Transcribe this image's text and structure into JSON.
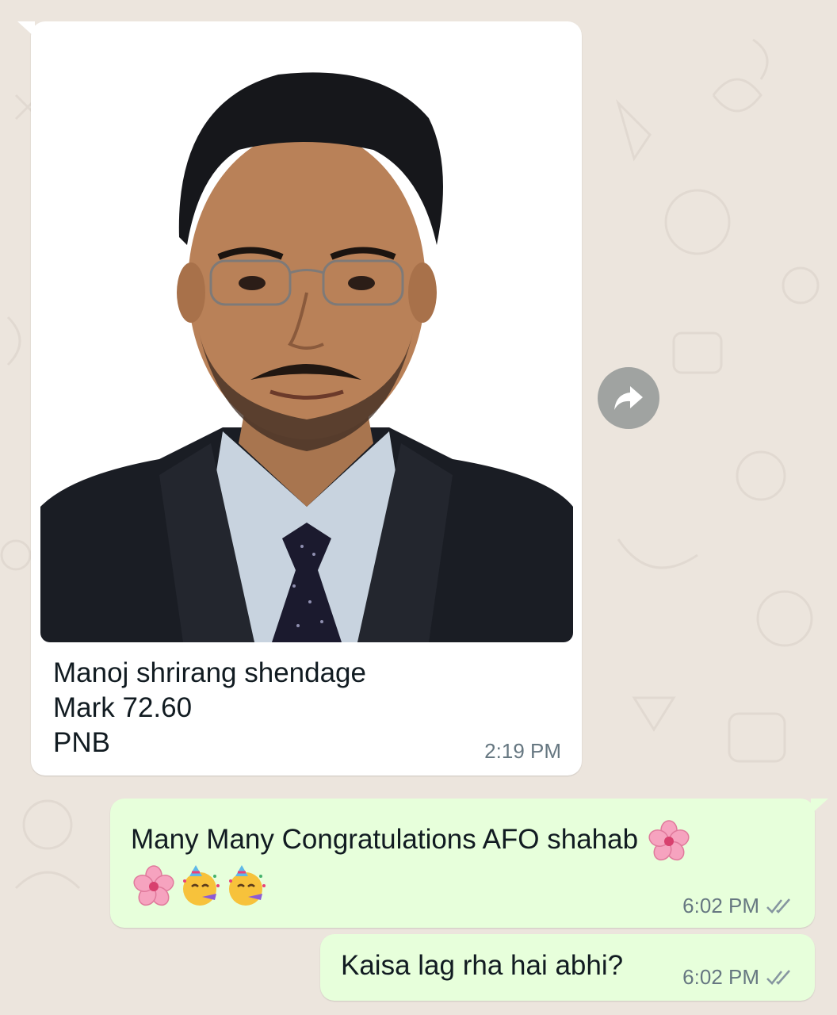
{
  "messages": {
    "incoming_image": {
      "caption_lines": [
        "Manoj shrirang shendage",
        "Mark 72.60",
        "PNB"
      ],
      "time": "2:19 PM",
      "photo_icon": "person-portrait-photo"
    },
    "forward_button": {
      "icon": "forward-arrow-icon"
    },
    "outgoing_1": {
      "text_part1": "Many Many Congratulations AFO shahab",
      "emojis": [
        "cherry-blossom-icon",
        "cherry-blossom-icon",
        "partying-face-icon",
        "partying-face-icon"
      ],
      "time": "6:02 PM",
      "status_icon": "double-check-icon"
    },
    "outgoing_2": {
      "text": "Kaisa lag rha hai abhi?",
      "time": "6:02 PM",
      "status_icon": "double-check-icon"
    }
  },
  "colors": {
    "chat_background": "#ece5dd",
    "incoming_bubble": "#ffffff",
    "outgoing_bubble": "#e7ffdb",
    "timestamp": "#667781",
    "forward_button": "#a0a3a1"
  }
}
